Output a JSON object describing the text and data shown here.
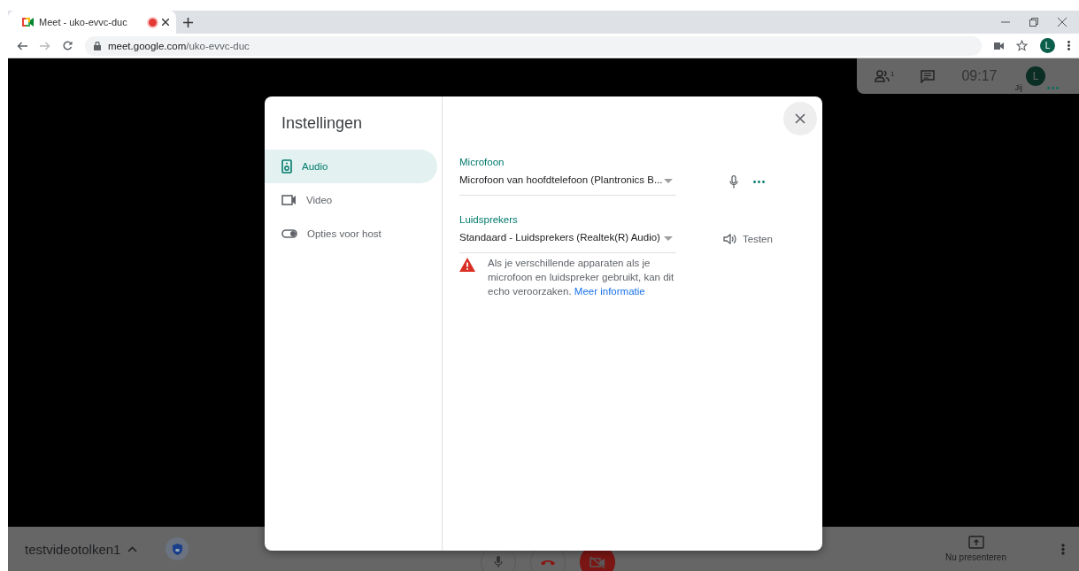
{
  "browser": {
    "tab": {
      "title": "Meet - uko-evvc-duc",
      "recording": true
    },
    "url": {
      "host": "meet.google.com",
      "path": "/uko-evvc-duc"
    },
    "profile_initial": "L"
  },
  "meeting_panel": {
    "participants_count": "1",
    "time": "09:17",
    "self_label": "Jij",
    "avatar_initial": "L"
  },
  "bottom_bar": {
    "meeting_name": "testvideotolken1",
    "camera_off": true,
    "present_label": "Nu presenteren"
  },
  "dialog": {
    "title": "Instellingen",
    "nav": [
      {
        "label": "Audio",
        "kind": "audio",
        "selected": true
      },
      {
        "label": "Video",
        "kind": "video",
        "selected": false
      },
      {
        "label": "Opties voor host",
        "kind": "host",
        "selected": false
      }
    ],
    "microphone": {
      "label": "Microfoon",
      "value": "Microfoon van hoofdtelefoon (Plantronics B..."
    },
    "speakers": {
      "label": "Luidsprekers",
      "value": "Standaard - Luidsprekers (Realtek(R) Audio)",
      "test_label": "Testen"
    },
    "warning": {
      "text": "Als je verschillende apparaten als je microfoon en luidspreker gebruikt, kan dit echo veroorzaken.",
      "link": "Meer informatie"
    }
  }
}
